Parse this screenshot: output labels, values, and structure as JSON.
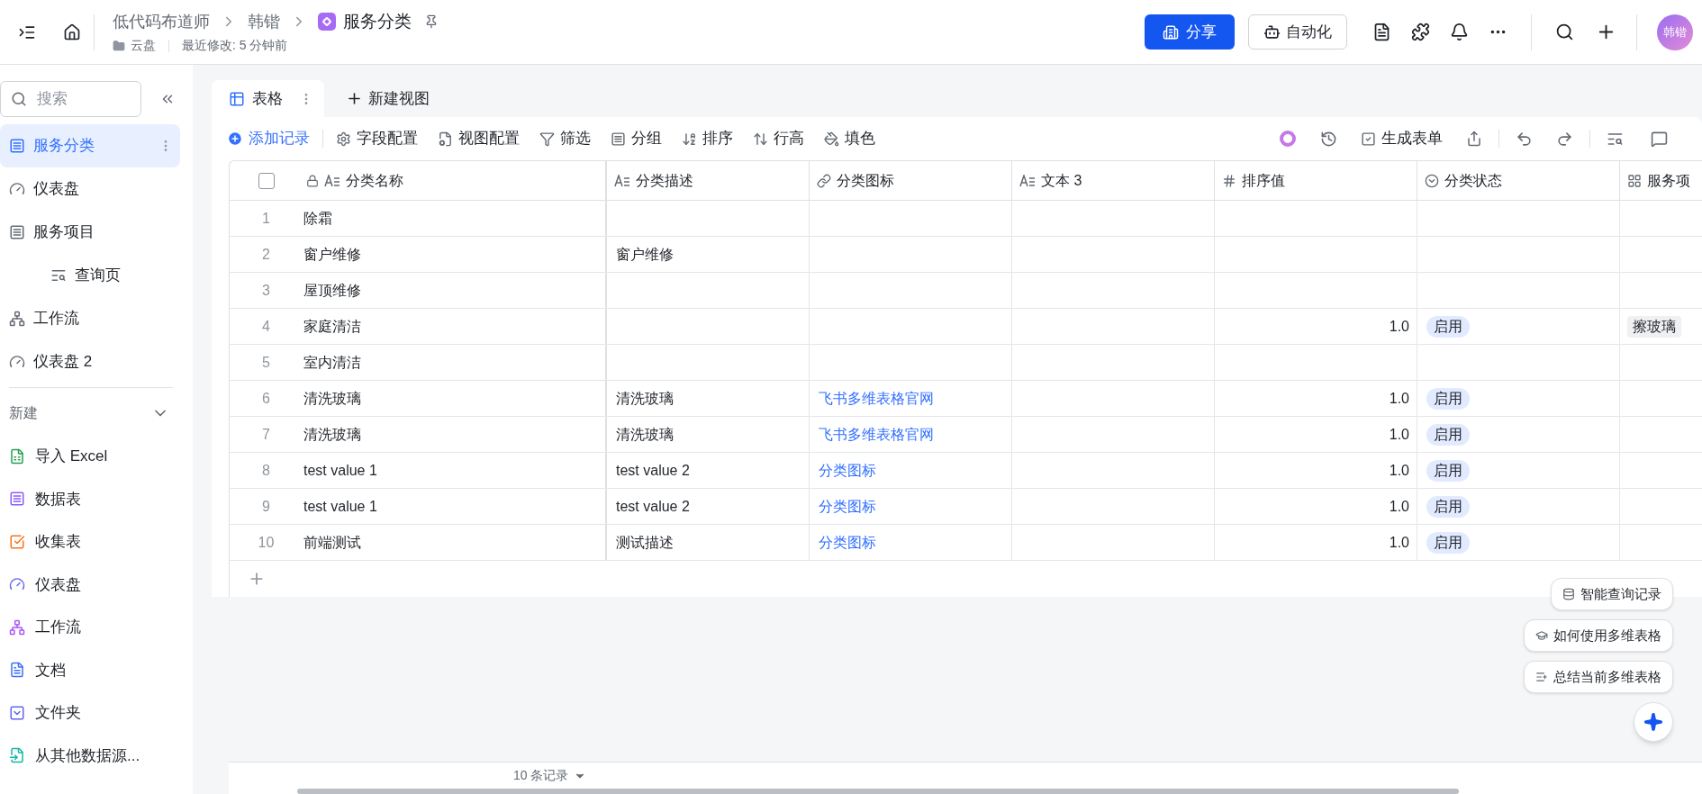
{
  "topbar": {
    "breadcrumbs": [
      "低代码布道师",
      "韩锴"
    ],
    "title": "服务分类",
    "location": "云盘",
    "modified": "最近修改: 5 分钟前",
    "share": "分享",
    "automation": "自动化",
    "avatar": "韩锴"
  },
  "sidebar": {
    "search": {
      "placeholder": "搜索"
    },
    "items": [
      {
        "label": "服务分类",
        "kind": "table",
        "selected": true
      },
      {
        "label": "仪表盘",
        "kind": "dashboard",
        "selected": false
      },
      {
        "label": "服务项目",
        "kind": "table",
        "selected": false,
        "children": [
          {
            "label": "查询页",
            "kind": "query",
            "selected": false
          }
        ]
      },
      {
        "label": "工作流",
        "kind": "workflow",
        "selected": false
      },
      {
        "label": "仪表盘 2",
        "kind": "dashboard",
        "selected": false
      }
    ],
    "new_section": {
      "title": "新建",
      "expanded": true,
      "items": [
        {
          "label": "导入 Excel",
          "kind": "excel"
        },
        {
          "label": "数据表",
          "kind": "table"
        },
        {
          "label": "收集表",
          "kind": "form"
        },
        {
          "label": "仪表盘",
          "kind": "dashboard"
        },
        {
          "label": "工作流",
          "kind": "workflow"
        },
        {
          "label": "文档",
          "kind": "doc"
        },
        {
          "label": "文件夹",
          "kind": "folder"
        },
        {
          "label": "从其他数据源...",
          "kind": "import"
        }
      ]
    }
  },
  "views": {
    "tabs": [
      {
        "label": "表格",
        "selected": true
      }
    ],
    "new_view": "新建视图"
  },
  "toolbar": {
    "add": "添加记录",
    "items": [
      {
        "label": "字段配置",
        "kind": "fields"
      },
      {
        "label": "视图配置",
        "kind": "view"
      },
      {
        "label": "筛选",
        "kind": "filter"
      },
      {
        "label": "分组",
        "kind": "group"
      },
      {
        "label": "排序",
        "kind": "sort"
      },
      {
        "label": "行高",
        "kind": "height"
      },
      {
        "label": "填色",
        "kind": "fill"
      }
    ],
    "generate_form": "生成表单"
  },
  "table": {
    "select_all": {
      "checked": false
    },
    "columns": [
      {
        "label": "分类名称",
        "kind": "text",
        "locked": true
      },
      {
        "label": "分类描述",
        "kind": "text",
        "locked": false
      },
      {
        "label": "分类图标",
        "kind": "link",
        "locked": false
      },
      {
        "label": "文本 3",
        "kind": "text",
        "locked": false
      },
      {
        "label": "排序值",
        "kind": "number",
        "locked": false
      },
      {
        "label": "分类状态",
        "kind": "select",
        "locked": false
      },
      {
        "label": "服务项",
        "kind": "lookup",
        "locked": false
      }
    ],
    "rows": [
      {
        "number": "1",
        "cells": [
          "除霜",
          null,
          null,
          null,
          null,
          null,
          null
        ]
      },
      {
        "number": "2",
        "cells": [
          "窗户维修",
          "窗户维修",
          null,
          null,
          null,
          null,
          null
        ]
      },
      {
        "number": "3",
        "cells": [
          "屋顶维修",
          null,
          null,
          null,
          null,
          null,
          null
        ]
      },
      {
        "number": "4",
        "cells": [
          "家庭清洁",
          null,
          null,
          null,
          "1.0",
          "启用",
          "擦玻璃"
        ]
      },
      {
        "number": "5",
        "cells": [
          "室内清洁",
          null,
          null,
          null,
          null,
          null,
          null
        ]
      },
      {
        "number": "6",
        "cells": [
          "清洗玻璃",
          "清洗玻璃",
          "飞书多维表格官网",
          null,
          "1.0",
          "启用",
          null
        ]
      },
      {
        "number": "7",
        "cells": [
          "清洗玻璃",
          "清洗玻璃",
          "飞书多维表格官网",
          null,
          "1.0",
          "启用",
          null
        ]
      },
      {
        "number": "8",
        "cells": [
          "test value 1",
          "test value 2",
          "分类图标",
          null,
          "1.0",
          "启用",
          null
        ]
      },
      {
        "number": "9",
        "cells": [
          "test value 1",
          "test value 2",
          "分类图标",
          null,
          "1.0",
          "启用",
          null
        ]
      },
      {
        "number": "10",
        "cells": [
          "前端测试",
          "测试描述",
          "分类图标",
          null,
          "1.0",
          "启用",
          null
        ]
      }
    ]
  },
  "footer": {
    "record_count": "10 条记录"
  },
  "assistant": {
    "suggestions": [
      {
        "label": "智能查询记录",
        "kind": "query"
      },
      {
        "label": "如何使用多维表格",
        "kind": "learn"
      },
      {
        "label": "总结当前多维表格",
        "kind": "summary"
      }
    ]
  }
}
